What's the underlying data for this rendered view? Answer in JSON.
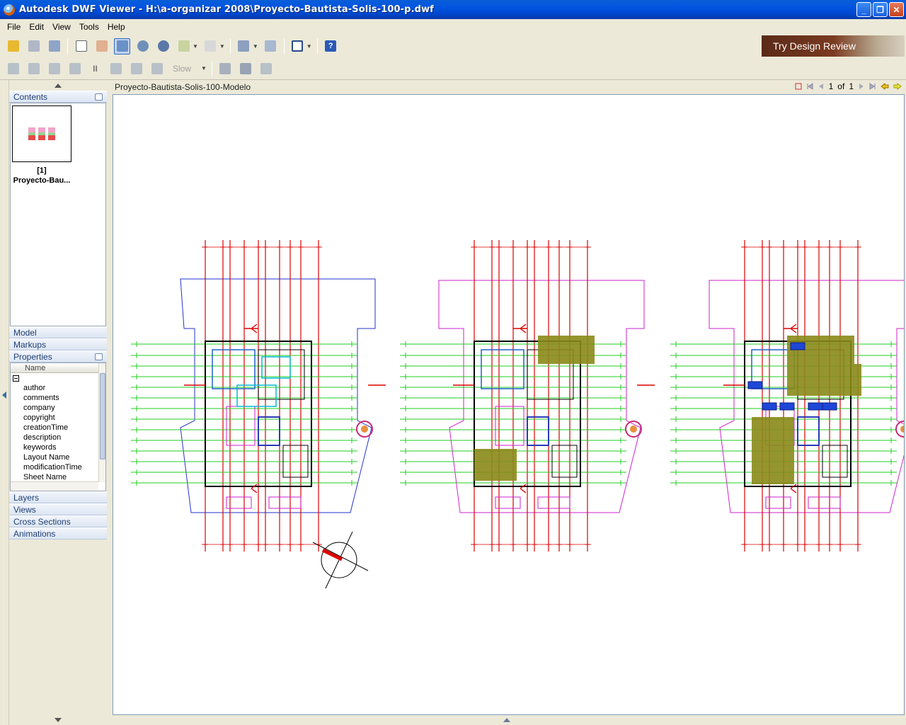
{
  "window": {
    "title": "Autodesk DWF Viewer - H:\\a-organizar 2008\\Proyecto-Bautista-Solis-100-p.dwf",
    "minimize": "_",
    "maximize": "❐",
    "close": "✕"
  },
  "menu": [
    "File",
    "Edit",
    "View",
    "Tools",
    "Help"
  ],
  "toolbar": {
    "try_design_review": "Try Design Review",
    "slow_label": "Slow"
  },
  "left_panel": {
    "contents_label": "Contents",
    "thumbnail_label_line1": "[1]",
    "thumbnail_label_line2": "Proyecto-Bau...",
    "model_label": "Model",
    "markups_label": "Markups",
    "properties_label": "Properties",
    "properties_column": "Name",
    "properties": [
      "author",
      "comments",
      "company",
      "copyright",
      "creationTime",
      "description",
      "keywords",
      "Layout Name",
      "modificationTime",
      "Sheet Name"
    ],
    "layers_label": "Layers",
    "views_label": "Views",
    "cross_sections_label": "Cross Sections",
    "animations_label": "Animations"
  },
  "document": {
    "sheet_name": "Proyecto-Bautista-Solis-100-Modelo",
    "page_current": "1",
    "page_of": "of",
    "page_total": "1"
  },
  "colors": {
    "grid_green": "#22cc22",
    "axis_red": "#dd0000",
    "outline_magenta": "#cc22cc",
    "outline_blue": "#2233cc",
    "fill_olive": "#8a8a1a"
  }
}
